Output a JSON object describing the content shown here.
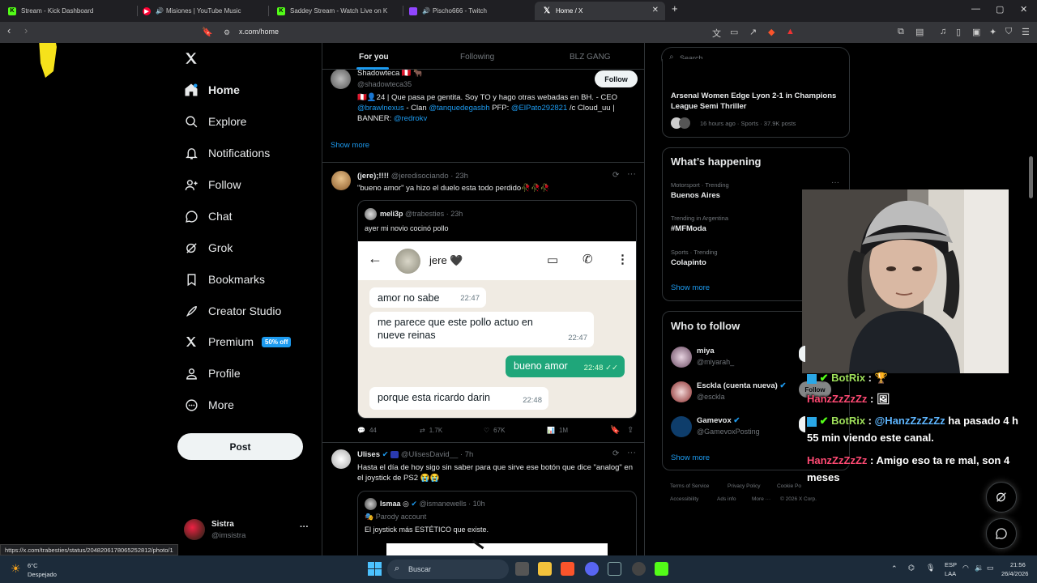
{
  "browser": {
    "tabs": [
      {
        "title": "Stream - Kick Dashboard",
        "color": "#53fc18",
        "glyph": "K"
      },
      {
        "title": "Misiones | YouTube Music",
        "color": "#ff0033",
        "glyph": "▶"
      },
      {
        "title": "Saddey Stream - Watch Live on K",
        "color": "#53fc18",
        "glyph": "K"
      },
      {
        "title": "Pischo666 - Twitch",
        "color": "#9146ff",
        "glyph": "▮"
      },
      {
        "title": "Home / X",
        "color": "#ffffff",
        "glyph": "X",
        "active": true
      }
    ],
    "new_tab": "+",
    "url": "x.com/home",
    "status_url": "https://x.com/trabesties/status/2048206178065252812/photo/1"
  },
  "nav": {
    "items": [
      {
        "label": "Home",
        "icon": "home-icon"
      },
      {
        "label": "Explore",
        "icon": "search-icon"
      },
      {
        "label": "Notifications",
        "icon": "bell-icon"
      },
      {
        "label": "Follow",
        "icon": "add-person-icon"
      },
      {
        "label": "Chat",
        "icon": "chat-icon"
      },
      {
        "label": "Grok",
        "icon": "grok-icon"
      },
      {
        "label": "Bookmarks",
        "icon": "bookmark-icon"
      },
      {
        "label": "Creator Studio",
        "icon": "rocket-icon"
      },
      {
        "label": "Premium",
        "icon": "x-logo-icon"
      },
      {
        "label": "Profile",
        "icon": "person-icon"
      },
      {
        "label": "More",
        "icon": "more-circle-icon"
      }
    ],
    "premium_badge": "50% off",
    "post_label": "Post",
    "account": {
      "name": "Sistra",
      "handle": "@imsistra",
      "menu": "···"
    }
  },
  "feed": {
    "tabs": [
      "For you",
      "Following",
      "BLZ GANG"
    ],
    "profile_card": {
      "name": "Shadowteca 🇵🇪 🐂",
      "handle": "@shadowteca35",
      "follow": "Follow",
      "bio_parts": [
        "🇵🇪👤24 | Que pasa pe gentita. Soy TO y hago otras webadas en BH. - CEO ",
        "@brawlnexus",
        " - Clan ",
        "@tanquedegasbh",
        " PFP: ",
        "@ElPato292821",
        " /c Cloud_uu | BANNER: ",
        "@redrokv"
      ]
    },
    "show_more": "Show more",
    "post1": {
      "name": "(jere);!!!!",
      "handle": "@jeredisociando",
      "time": "· 23h",
      "text": "\"bueno amor\" ya hizo el duelo esta todo perdido🥀🥀🥀",
      "quote": {
        "name": "meli3p",
        "handle": "@trabesties",
        "time": "· 23h",
        "text": "ayer mi novio cocinó pollo",
        "chat": {
          "contact": "jere 🖤",
          "messages": [
            {
              "text": "amor no sabe",
              "time": "22:47",
              "me": false
            },
            {
              "text": "me parece que este pollo actuo en nueve reinas",
              "time": "22:47",
              "me": false
            },
            {
              "text": "bueno amor",
              "time": "22:48 ✓✓",
              "me": true
            },
            {
              "text": "porque esta ricardo darin",
              "time": "22:48",
              "me": false
            }
          ]
        }
      },
      "actions": {
        "replies": "44",
        "reposts": "1.7K",
        "likes": "67K",
        "views": "1M"
      }
    },
    "post2": {
      "name": "Ulises",
      "handle": "@UlisesDavid__",
      "time": "· 7h",
      "text": "Hasta el día de hoy sigo sin saber para que sirve ese botón que dice \"analog\" en el joystick de PS2 😭😭",
      "quote": {
        "name": "Ismaa",
        "handle": "@ismanewells",
        "time": "· 10h",
        "label": "Parody account",
        "text": "El joystick más ESTÉTICO que existe."
      }
    }
  },
  "right": {
    "search_placeholder": "Search",
    "news": {
      "title": "Arsenal Women Edge Lyon 2-1 in Champions League Semi Thriller",
      "meta": "16 hours ago · Sports · 37.9K posts"
    },
    "happening": {
      "title": "What’s happening",
      "trends": [
        {
          "meta": "Motorsport · Trending",
          "name": "Buenos Aires"
        },
        {
          "meta": "Trending in Argentina",
          "name": "#MFModa"
        },
        {
          "meta": "Sports · Trending",
          "name": "Colapinto"
        }
      ],
      "more_dots": "···",
      "show_more": "Show more"
    },
    "who_to_follow": {
      "title": "Who to follow",
      "users": [
        {
          "name": "miya",
          "handle": "@miyarah_",
          "verified": false
        },
        {
          "name": "Esckla (cuenta nueva)",
          "handle": "@esckla",
          "verified": true
        },
        {
          "name": "Gamevox",
          "handle": "@GamevoxPosting",
          "verified": true
        }
      ],
      "follow": "Follow",
      "show_more": "Show more"
    },
    "footer": [
      "Terms of Service",
      "Privacy Policy",
      "Cookie Po",
      "Accessibility",
      "Ads info",
      "More ···",
      "© 2026 X Corp."
    ]
  },
  "overlay_chat": [
    {
      "user": "BotRix",
      "sep": " :",
      "msg": "🏆"
    },
    {
      "user": "HanzZzZzZz",
      "sep": " :",
      "msg": "🖼"
    },
    {
      "user": "BotRix",
      "sep": " :",
      "mention": "@HanzZzZzZz",
      "msg": " ha pasado 4 h 55 min viendo este canal."
    },
    {
      "user": "HanzZzZzZz",
      "sep": " :",
      "msg": " Amigo eso ta re mal, son 4 meses"
    }
  ],
  "taskbar": {
    "weather_temp": "6°C",
    "weather_desc": "Despejado",
    "search_placeholder": "Buscar",
    "lang_top": "ESP",
    "lang_bottom": "LAA",
    "time": "21:56",
    "date": "26/4/2026"
  },
  "colors": {
    "accent": "#1d9bf0",
    "bg": "#000000",
    "border": "#2f3336",
    "muted": "#71767b"
  }
}
